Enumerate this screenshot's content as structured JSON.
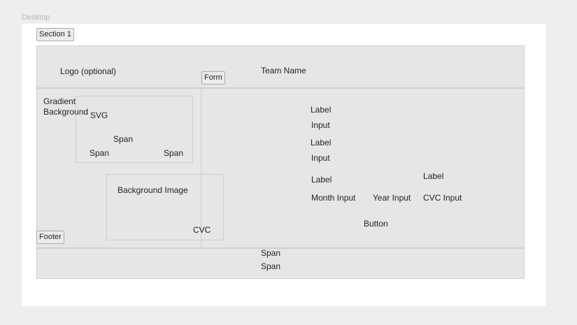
{
  "canvas": {
    "label": "Desktop"
  },
  "section": {
    "label": "Section 1"
  },
  "header": {
    "logo": "Logo (optional)",
    "team_name": "Team Name"
  },
  "form_badge": "Form",
  "left_panel": {
    "gradient_label": "Gradient Background",
    "svg_label": "SVG",
    "span_center": "Span",
    "span_left": "Span",
    "span_right": "Span",
    "bg_image_label": "Background Image",
    "cvc_label": "CVC",
    "footer_badge": "Footer"
  },
  "form": {
    "label_1": "Label",
    "input_1": "Input",
    "label_2": "Label",
    "input_2": "Input",
    "label_3": "Label",
    "label_4": "Label",
    "month_input": "Month Input",
    "year_input": "Year Input",
    "cvc_input": "CVC Input",
    "button": "Button"
  },
  "footer": {
    "span_1": "Span",
    "span_2": "Span"
  }
}
